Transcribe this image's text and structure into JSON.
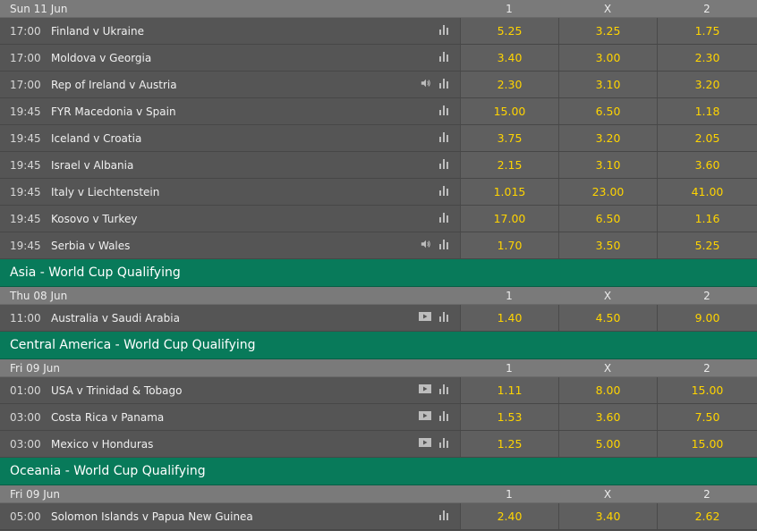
{
  "blocks": [
    {
      "date": "Sun 11 Jun",
      "headers": [
        "1",
        "X",
        "2"
      ],
      "matches": [
        {
          "time": "17:00",
          "name": "Finland v Ukraine",
          "odds": [
            "5.25",
            "3.25",
            "1.75"
          ],
          "icons": [
            "stats-icon"
          ]
        },
        {
          "time": "17:00",
          "name": "Moldova v Georgia",
          "odds": [
            "3.40",
            "3.00",
            "2.30"
          ],
          "icons": [
            "stats-icon"
          ]
        },
        {
          "time": "17:00",
          "name": "Rep of Ireland v Austria",
          "odds": [
            "2.30",
            "3.10",
            "3.20"
          ],
          "icons": [
            "audio-icon",
            "stats-icon"
          ]
        },
        {
          "time": "19:45",
          "name": "FYR Macedonia v Spain",
          "odds": [
            "15.00",
            "6.50",
            "1.18"
          ],
          "icons": [
            "stats-icon"
          ]
        },
        {
          "time": "19:45",
          "name": "Iceland v Croatia",
          "odds": [
            "3.75",
            "3.20",
            "2.05"
          ],
          "icons": [
            "stats-icon"
          ]
        },
        {
          "time": "19:45",
          "name": "Israel v Albania",
          "odds": [
            "2.15",
            "3.10",
            "3.60"
          ],
          "icons": [
            "stats-icon"
          ]
        },
        {
          "time": "19:45",
          "name": "Italy v Liechtenstein",
          "odds": [
            "1.015",
            "23.00",
            "41.00"
          ],
          "icons": [
            "stats-icon"
          ]
        },
        {
          "time": "19:45",
          "name": "Kosovo v Turkey",
          "odds": [
            "17.00",
            "6.50",
            "1.16"
          ],
          "icons": [
            "stats-icon"
          ]
        },
        {
          "time": "19:45",
          "name": "Serbia v Wales",
          "odds": [
            "1.70",
            "3.50",
            "5.25"
          ],
          "icons": [
            "audio-icon",
            "stats-icon"
          ]
        }
      ]
    },
    {
      "section": "Asia - World Cup Qualifying",
      "date": "Thu 08 Jun",
      "headers": [
        "1",
        "X",
        "2"
      ],
      "matches": [
        {
          "time": "11:00",
          "name": "Australia v Saudi Arabia",
          "odds": [
            "1.40",
            "4.50",
            "9.00"
          ],
          "icons": [
            "video-icon",
            "stats-icon"
          ]
        }
      ]
    },
    {
      "section": "Central America - World Cup Qualifying",
      "date": "Fri 09 Jun",
      "headers": [
        "1",
        "X",
        "2"
      ],
      "matches": [
        {
          "time": "01:00",
          "name": "USA v Trinidad & Tobago",
          "odds": [
            "1.11",
            "8.00",
            "15.00"
          ],
          "icons": [
            "video-icon",
            "stats-icon"
          ]
        },
        {
          "time": "03:00",
          "name": "Costa Rica v Panama",
          "odds": [
            "1.53",
            "3.60",
            "7.50"
          ],
          "icons": [
            "video-icon",
            "stats-icon"
          ]
        },
        {
          "time": "03:00",
          "name": "Mexico v Honduras",
          "odds": [
            "1.25",
            "5.00",
            "15.00"
          ],
          "icons": [
            "video-icon",
            "stats-icon"
          ]
        }
      ]
    },
    {
      "section": "Oceania - World Cup Qualifying",
      "date": "Fri 09 Jun",
      "headers": [
        "1",
        "X",
        "2"
      ],
      "matches": [
        {
          "time": "05:00",
          "name": "Solomon Islands v Papua New Guinea",
          "odds": [
            "2.40",
            "3.40",
            "2.62"
          ],
          "icons": [
            "stats-icon"
          ]
        }
      ]
    }
  ],
  "colors": {
    "odds": "#ffd400",
    "section": "#087a5a",
    "date_bar": "#7a7a7a"
  }
}
